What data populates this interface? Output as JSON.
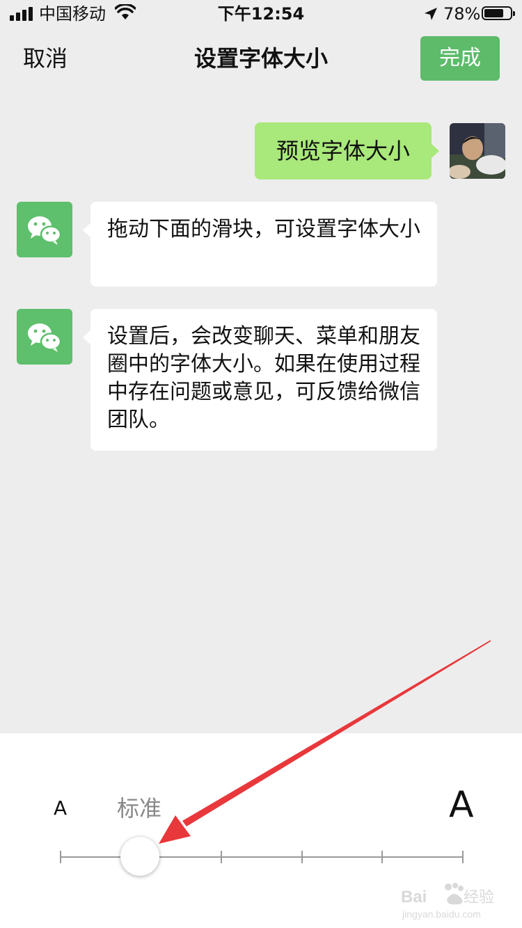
{
  "status_bar": {
    "carrier": "中国移动",
    "time": "下午12:54",
    "battery_percent": "78%",
    "battery_level": 0.78
  },
  "nav": {
    "cancel_label": "取消",
    "title": "设置字体大小",
    "done_label": "完成"
  },
  "chat": {
    "my_message": "预览字体大小",
    "messages": [
      {
        "text": "拖动下面的滑块，可设置字体大小"
      },
      {
        "text": "设置后，会改变聊天、菜单和朋友圈中的字体大小。如果在使用过程中存在问题或意见，可反馈给微信团队。"
      }
    ]
  },
  "font_slider": {
    "small_label": "A",
    "current_label": "标准",
    "large_label": "A",
    "steps": 6,
    "selected_step": 1
  },
  "colors": {
    "accent_green": "#5dbb6a",
    "my_bubble": "#a9e87a",
    "annotation_arrow": "#e8383b"
  },
  "icons": [
    "signal-icon",
    "wifi-icon",
    "location-arrow-icon",
    "battery-icon",
    "wechat-logo-icon"
  ],
  "watermark": {
    "brand": "Baidu经验",
    "url": "jingyan.baidu.com"
  }
}
